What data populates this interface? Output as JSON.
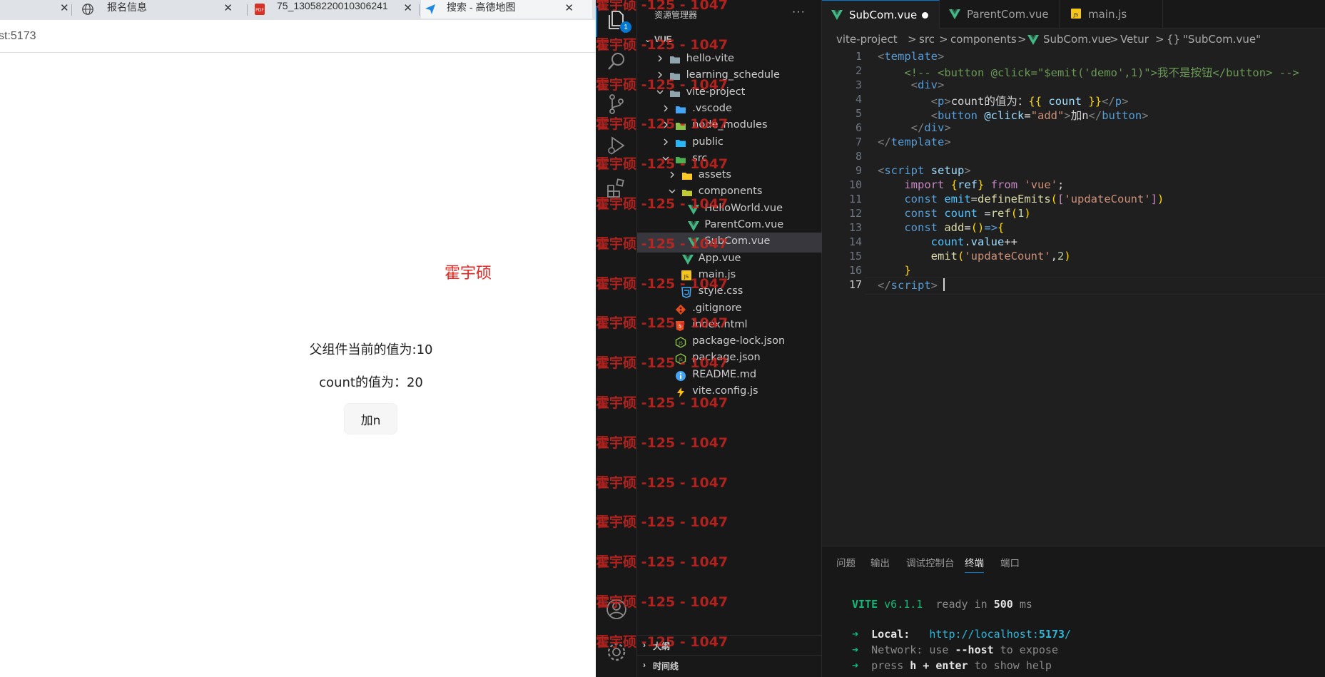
{
  "browser": {
    "tabs": [
      {
        "label": "报名信息",
        "icon": "globe-icon"
      },
      {
        "label": "75_13058220010306241",
        "icon": "pdf-icon"
      },
      {
        "label": "搜索 - 高德地图",
        "icon": "map-arrow-icon"
      }
    ],
    "close_glyph": "✕",
    "address": {
      "visible_text": "st:5173"
    }
  },
  "page": {
    "author": "霍宇硕",
    "parent_value_text": "父组件当前的值为:10",
    "count_text": "count的值为：20",
    "add_button_label": "加n"
  },
  "vscode": {
    "explorer_badge": "1",
    "sidebar_title": "资源管理器",
    "sidebar_more": "···",
    "workspace": "VUE",
    "tree": [
      {
        "name": "hello-vite",
        "type": "folder",
        "depth": 1,
        "expanded": false,
        "icon_color": "#90a4ae"
      },
      {
        "name": "learning_schedule",
        "type": "folder",
        "depth": 1,
        "expanded": false,
        "icon_color": "#90a4ae"
      },
      {
        "name": "vite-project",
        "type": "folder",
        "depth": 1,
        "expanded": true,
        "icon_color": "#90a4ae"
      },
      {
        "name": ".vscode",
        "type": "folder",
        "depth": 2,
        "expanded": false,
        "icon_color": "#42a5f5"
      },
      {
        "name": "node_modules",
        "type": "folder",
        "depth": 2,
        "expanded": false,
        "icon_color": "#8bc34a"
      },
      {
        "name": "public",
        "type": "folder",
        "depth": 2,
        "expanded": false,
        "icon_color": "#29b6f6"
      },
      {
        "name": "src",
        "type": "folder",
        "depth": 2,
        "expanded": true,
        "icon_color": "#4caf50"
      },
      {
        "name": "assets",
        "type": "folder",
        "depth": 3,
        "expanded": false,
        "icon_color": "#ffca28"
      },
      {
        "name": "components",
        "type": "folder",
        "depth": 3,
        "expanded": true,
        "icon_color": "#c0ca33"
      },
      {
        "name": "HelloWorld.vue",
        "type": "vue",
        "depth": 4
      },
      {
        "name": "ParentCom.vue",
        "type": "vue",
        "depth": 4
      },
      {
        "name": "SubCom.vue",
        "type": "vue",
        "depth": 4,
        "selected": true
      },
      {
        "name": "App.vue",
        "type": "vue",
        "depth": 3
      },
      {
        "name": "main.js",
        "type": "js",
        "depth": 3
      },
      {
        "name": "style.css",
        "type": "css",
        "depth": 3
      },
      {
        "name": ".gitignore",
        "type": "git",
        "depth": 2
      },
      {
        "name": "index.html",
        "type": "html",
        "depth": 2
      },
      {
        "name": "package-lock.json",
        "type": "nodejs",
        "depth": 2
      },
      {
        "name": "package.json",
        "type": "nodejs",
        "depth": 2
      },
      {
        "name": "README.md",
        "type": "info",
        "depth": 2
      },
      {
        "name": "vite.config.js",
        "type": "vite",
        "depth": 2
      }
    ],
    "outline_label": "大纲",
    "timeline_label": "时间线",
    "editor_tabs": [
      {
        "label": "SubCom.vue",
        "type": "vue",
        "active": true,
        "dirty": true
      },
      {
        "label": "ParentCom.vue",
        "type": "vue",
        "active": false
      },
      {
        "label": "main.js",
        "type": "js",
        "active": false
      }
    ],
    "breadcrumb": [
      "vite-project",
      "src",
      "components",
      "SubCom.vue",
      "Vetur",
      "\"SubCom.vue\""
    ],
    "breadcrumb_sep": ">",
    "breadcrumb_braces": "{}",
    "current_line": 17,
    "code_lines": [
      [
        [
          "t-angle",
          "<"
        ],
        [
          "t-tag",
          "template"
        ],
        [
          "t-angle",
          ">"
        ]
      ],
      [
        [
          "t-txt",
          "    "
        ],
        [
          "t-cm",
          "<!-- <button @click=\"$emit('demo',1)\">我不是按钮</button> -->"
        ]
      ],
      [
        [
          "t-txt",
          "     "
        ],
        [
          "t-angle",
          "<"
        ],
        [
          "t-tag",
          "div"
        ],
        [
          "t-angle",
          ">"
        ]
      ],
      [
        [
          "t-txt",
          "        "
        ],
        [
          "t-angle",
          "<"
        ],
        [
          "t-tag",
          "p"
        ],
        [
          "t-angle",
          ">"
        ],
        [
          "t-txt",
          "count的值为："
        ],
        [
          "t-br",
          "{{"
        ],
        [
          "t-txt",
          " "
        ],
        [
          "t-prop",
          "count"
        ],
        [
          "t-txt",
          " "
        ],
        [
          "t-br",
          "}}"
        ],
        [
          "t-angle",
          "</"
        ],
        [
          "t-tag",
          "p"
        ],
        [
          "t-angle",
          ">"
        ]
      ],
      [
        [
          "t-txt",
          "        "
        ],
        [
          "t-angle",
          "<"
        ],
        [
          "t-tag",
          "button"
        ],
        [
          "t-txt",
          " "
        ],
        [
          "t-attr",
          "@click"
        ],
        [
          "t-txt",
          "="
        ],
        [
          "t-str",
          "\"add\""
        ],
        [
          "t-angle",
          ">"
        ],
        [
          "t-txt",
          "加n"
        ],
        [
          "t-angle",
          "</"
        ],
        [
          "t-tag",
          "button"
        ],
        [
          "t-angle",
          ">"
        ]
      ],
      [
        [
          "t-txt",
          "     "
        ],
        [
          "t-angle",
          "</"
        ],
        [
          "t-tag",
          "div"
        ],
        [
          "t-angle",
          ">"
        ]
      ],
      [
        [
          "t-angle",
          "</"
        ],
        [
          "t-tag",
          "template"
        ],
        [
          "t-angle",
          ">"
        ]
      ],
      [],
      [
        [
          "t-angle",
          "<"
        ],
        [
          "t-tag",
          "script"
        ],
        [
          "t-txt",
          " "
        ],
        [
          "t-attr",
          "setup"
        ],
        [
          "t-angle",
          ">"
        ]
      ],
      [
        [
          "t-txt",
          "    "
        ],
        [
          "t-ctl",
          "import"
        ],
        [
          "t-txt",
          " "
        ],
        [
          "t-br",
          "{"
        ],
        [
          "t-prop",
          "ref"
        ],
        [
          "t-br",
          "}"
        ],
        [
          "t-txt",
          " "
        ],
        [
          "t-ctl",
          "from"
        ],
        [
          "t-txt",
          " "
        ],
        [
          "t-str",
          "'vue'"
        ],
        [
          "t-txt",
          ";"
        ]
      ],
      [
        [
          "t-txt",
          "    "
        ],
        [
          "t-kw",
          "const"
        ],
        [
          "t-txt",
          " "
        ],
        [
          "t-var",
          "emit"
        ],
        [
          "t-txt",
          "="
        ],
        [
          "t-fn",
          "defineEmits"
        ],
        [
          "t-br",
          "("
        ],
        [
          "t-ctl",
          "["
        ],
        [
          "t-str",
          "'updateCount'"
        ],
        [
          "t-ctl",
          "]"
        ],
        [
          "t-br",
          ")"
        ]
      ],
      [
        [
          "t-txt",
          "    "
        ],
        [
          "t-kw",
          "const"
        ],
        [
          "t-txt",
          " "
        ],
        [
          "t-var",
          "count"
        ],
        [
          "t-txt",
          " ="
        ],
        [
          "t-fn",
          "ref"
        ],
        [
          "t-br",
          "("
        ],
        [
          "t-num",
          "1"
        ],
        [
          "t-br",
          ")"
        ]
      ],
      [
        [
          "t-txt",
          "    "
        ],
        [
          "t-kw",
          "const"
        ],
        [
          "t-txt",
          " "
        ],
        [
          "t-fn",
          "add"
        ],
        [
          "t-txt",
          "="
        ],
        [
          "t-br",
          "("
        ],
        [
          "t-br",
          ")"
        ],
        [
          "t-kw",
          "=>"
        ],
        [
          "t-br",
          "{"
        ]
      ],
      [
        [
          "t-txt",
          "        "
        ],
        [
          "t-var",
          "count"
        ],
        [
          "t-txt",
          "."
        ],
        [
          "t-prop",
          "value"
        ],
        [
          "t-txt",
          "++"
        ]
      ],
      [
        [
          "t-txt",
          "        "
        ],
        [
          "t-fn",
          "emit"
        ],
        [
          "t-br",
          "("
        ],
        [
          "t-str",
          "'updateCount'"
        ],
        [
          "t-txt",
          ","
        ],
        [
          "t-num",
          "2"
        ],
        [
          "t-br",
          ")"
        ]
      ],
      [
        [
          "t-txt",
          "    "
        ],
        [
          "t-br",
          "}"
        ]
      ],
      [
        [
          "t-angle",
          "</"
        ],
        [
          "t-tag",
          "script"
        ],
        [
          "t-angle",
          ">"
        ]
      ]
    ],
    "panel_tabs": [
      {
        "label": "问题",
        "active": false
      },
      {
        "label": "输出",
        "active": false
      },
      {
        "label": "调试控制台",
        "active": false
      },
      {
        "label": "终端",
        "active": true
      },
      {
        "label": "端口",
        "active": false
      }
    ],
    "terminal": {
      "vite_name": "VITE",
      "vite_version": "v6.1.1",
      "ready_pre": "ready in",
      "ready_ms": "500",
      "ready_unit": "ms",
      "arrow": "➜",
      "local_label": "Local:",
      "local_url_pre": "http://localhost:",
      "local_port": "5173",
      "local_url_post": "/",
      "network_label": "Network:",
      "network_pre": "use",
      "network_flag": "--host",
      "network_post": "to expose",
      "help_pre": "press",
      "help_key": "h + enter",
      "help_post": "to show help"
    }
  },
  "watermark": {
    "text": "霍宇硕 -125 - 1047"
  }
}
